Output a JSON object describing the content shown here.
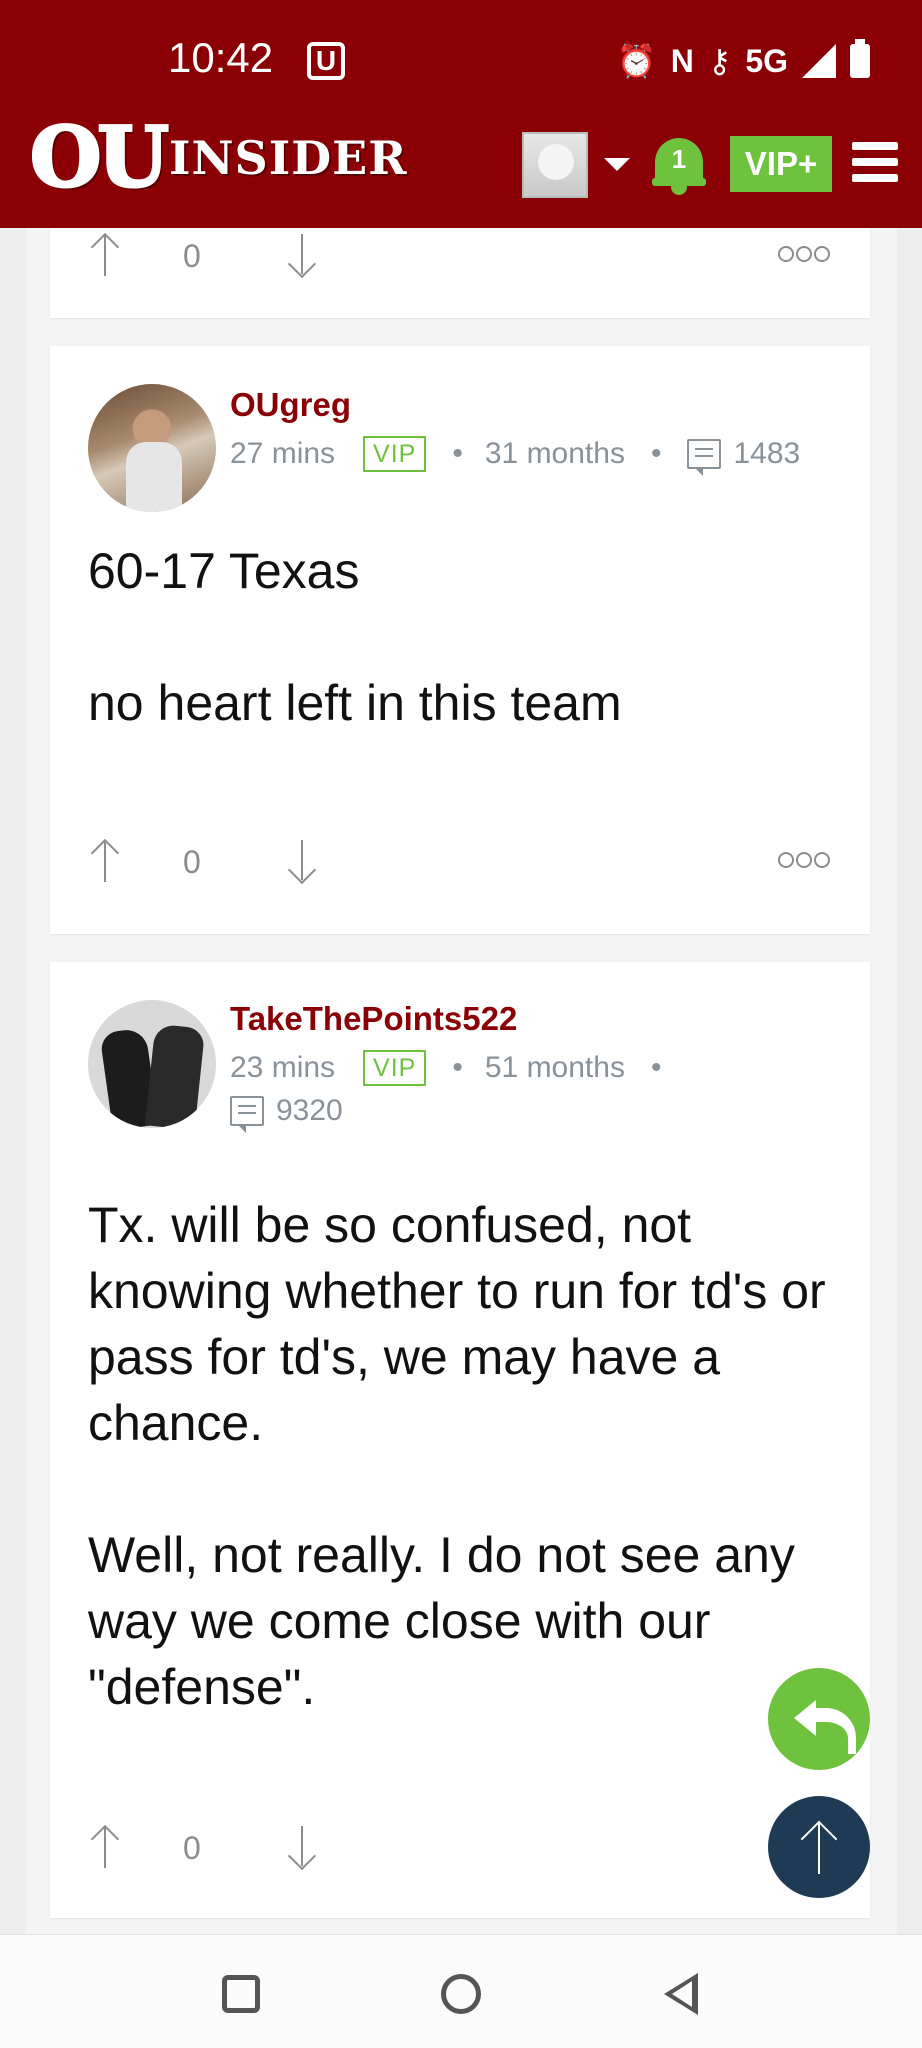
{
  "status_bar": {
    "time": "10:42",
    "carrier_badge": "U",
    "network": "5G",
    "icons": [
      "alarm-icon",
      "nfc-icon",
      "vpn-key-icon",
      "signal-icon",
      "battery-icon"
    ]
  },
  "header": {
    "logo_ou": "OU",
    "logo_insider": "INSIDER",
    "notification_count": "1",
    "vip_label": "VIP+",
    "colors": {
      "bar": "#8b0004",
      "accent": "#6ec23d"
    }
  },
  "posts": [
    {
      "votes": "0"
    },
    {
      "username": "OUgreg",
      "time_ago": "27 mins",
      "badge": "VIP",
      "membership": "31 months",
      "post_count": "1483",
      "body": [
        "60-17 Texas",
        "no heart left in this team"
      ],
      "votes": "0"
    },
    {
      "username": "TakeThePoints522",
      "time_ago": "23 mins",
      "badge": "VIP",
      "membership": "51 months",
      "post_count": "9320",
      "body": [
        "Tx. will be so confused, not knowing whether to run for td's or pass for td's, we may have a chance.",
        "Well, not really. I do not see any way we come close with our \"defense\"."
      ],
      "votes": "0"
    }
  ],
  "separator": "•"
}
